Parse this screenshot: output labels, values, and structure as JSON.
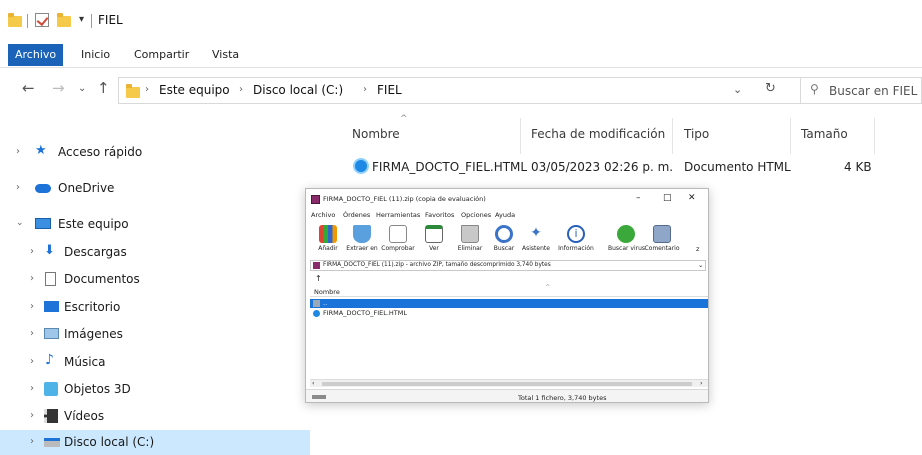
{
  "window": {
    "title": "FIEL"
  },
  "ribbon": {
    "tabs": [
      "Archivo",
      "Inicio",
      "Compartir",
      "Vista"
    ]
  },
  "address": {
    "crumbs": [
      "Este equipo",
      "Disco local (C:)",
      "FIEL"
    ]
  },
  "search": {
    "placeholder": "Buscar en FIEL"
  },
  "sidebar": {
    "items": [
      {
        "label": "Acceso rápido",
        "icon": "star-icon"
      },
      {
        "label": "OneDrive",
        "icon": "cloud-icon"
      },
      {
        "label": "Este equipo",
        "icon": "computer-icon"
      },
      {
        "label": "Descargas",
        "icon": "download-icon"
      },
      {
        "label": "Documentos",
        "icon": "document-icon"
      },
      {
        "label": "Escritorio",
        "icon": "desktop-icon"
      },
      {
        "label": "Imágenes",
        "icon": "pictures-icon"
      },
      {
        "label": "Música",
        "icon": "music-icon"
      },
      {
        "label": "Objetos 3D",
        "icon": "cube-icon"
      },
      {
        "label": "Vídeos",
        "icon": "video-icon"
      },
      {
        "label": "Disco local (C:)",
        "icon": "drive-icon"
      }
    ]
  },
  "columns": {
    "name": "Nombre",
    "modified": "Fecha de modificación",
    "type": "Tipo",
    "size": "Tamaño"
  },
  "file": {
    "name": "FIRMA_DOCTO_FIEL.HTML",
    "modified": "03/05/2023 02:26 p. m.",
    "type": "Documento HTML",
    "size": "4 KB"
  },
  "rar": {
    "title": "FIRMA_DOCTO_FIEL (11).zip (copia de evaluación)",
    "menu": [
      "Archivo",
      "Órdenes",
      "Herramientas",
      "Favoritos",
      "Opciones",
      "Ayuda"
    ],
    "toolbar": [
      "Añadir",
      "Extraer en",
      "Comprobar",
      "Ver",
      "Eliminar",
      "Buscar",
      "Asistente",
      "Información",
      "Buscar virus",
      "Comentario",
      "z"
    ],
    "path": "FIRMA_DOCTO_FIEL (11).zip - archivo ZIP, tamaño descomprimido 3,740 bytes",
    "column": "Nombre",
    "up_row": "..",
    "file": "FIRMA_DOCTO_FIEL.HTML",
    "status": "Total 1 fichero, 3,740 bytes",
    "controls": {
      "minimize": "–",
      "maximize": "□",
      "close": "✕"
    }
  },
  "colors": {
    "accent": "#1a63b8",
    "selection": "#cce8ff",
    "folder": "#f5c94a"
  }
}
